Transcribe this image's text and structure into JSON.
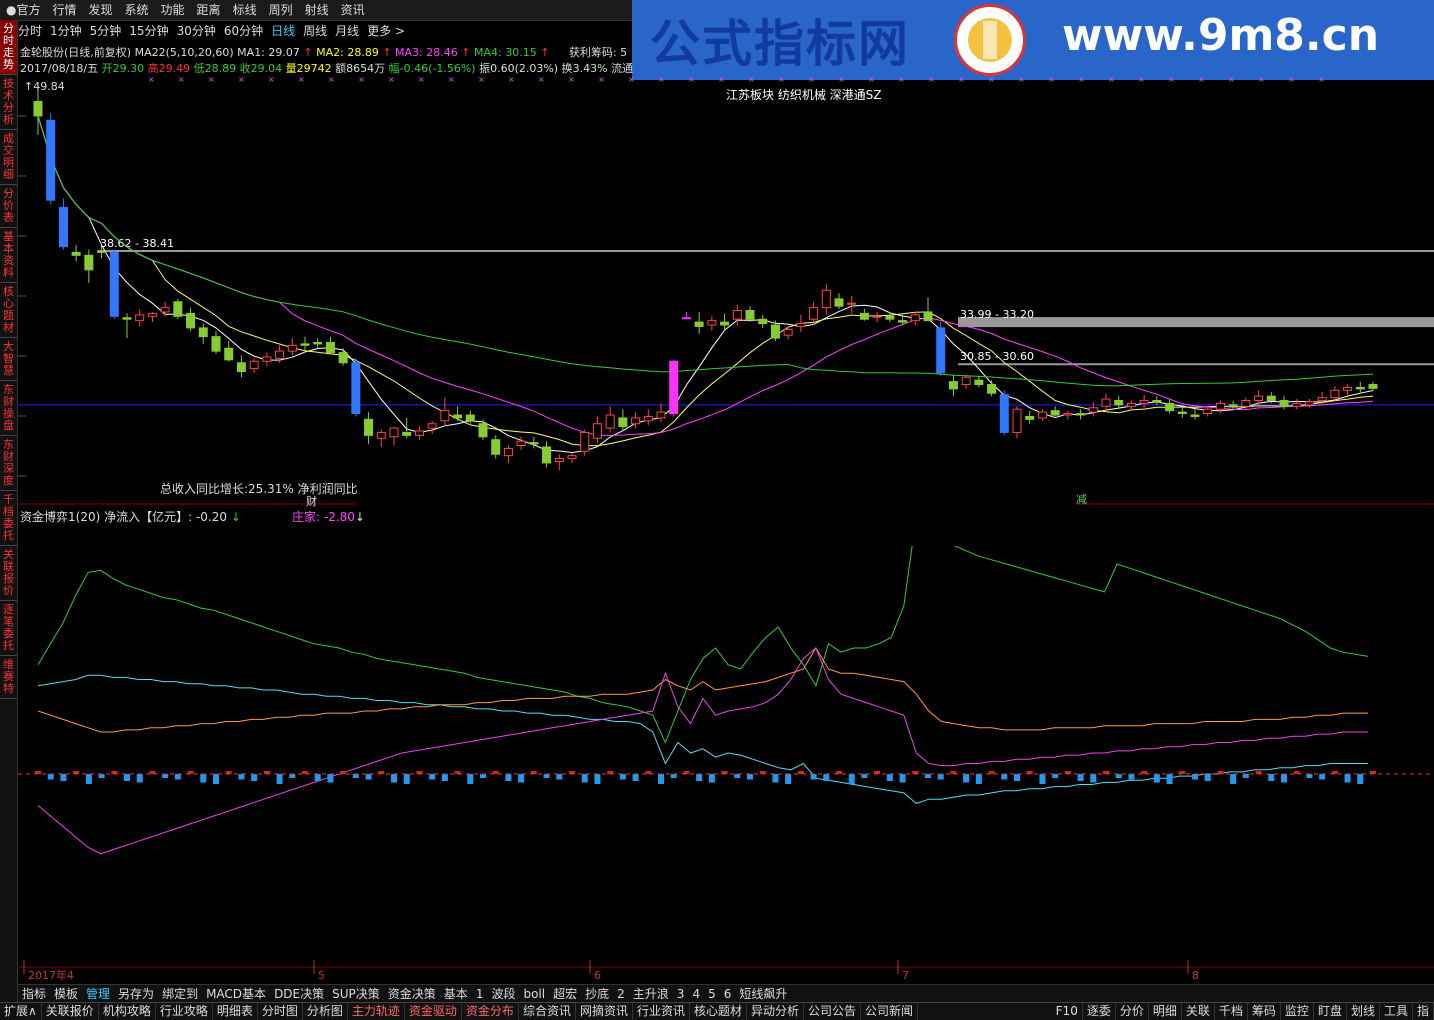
{
  "top_menu": [
    "●官方",
    "行情",
    "发现",
    "系统",
    "功能",
    "距离",
    "标线",
    "周列",
    "射线",
    "资讯"
  ],
  "banner": {
    "title": "公式指标网",
    "url": "www.9m8.cn"
  },
  "sidebar": [
    "分时走势",
    "技术分析",
    "成交明细",
    "分价表",
    "基本资料",
    "核心题材",
    "大智慧",
    "东财操盘",
    "东财深度",
    "千档委托",
    "关联报价",
    "逐笔委托",
    "维赛特"
  ],
  "periods": [
    "分时",
    "1分钟",
    "5分钟",
    "15分钟",
    "30分钟",
    "60分钟",
    "日线",
    "周线",
    "月线",
    "更多 >"
  ],
  "active_period": "日线",
  "stock_line": {
    "name": "金轮股份(日线,前复权)",
    "ma22": "MA22(5,10,20,60)",
    "ma1": "MA1: 29.07",
    "ma2": "MA2: 28.89",
    "ma3": "MA3: 28.46",
    "ma4": "MA4: 30.15",
    "chip": "获利筹码: 5"
  },
  "quote_line": {
    "date": "2017/08/18/五",
    "open": "开29.30",
    "high": "高29.49",
    "low": "低28.89",
    "close": "收29.04",
    "vol": "量29742",
    "amount": "额8654万",
    "range": "幅-0.46(-1.56%)",
    "amp": "振0.60(2.03%)",
    "turn": "换3.43%",
    "flow": "流通"
  },
  "max_label": "49.84",
  "sector_label": "江苏板块 纺织机械 深港通SZ",
  "price_labels": [
    "38.62 - 38.41",
    "33.99 - 33.20",
    "30.85 - 30.60"
  ],
  "growth_text": "总收入同比增长:25.31%  净利润同比增",
  "marker_right": "减",
  "marker_left": "财",
  "indicator": {
    "name": "资金博弈1(20)",
    "net_in": "净流入【亿元】: -0.20",
    "zhuangjia": "庄家: -2.80"
  },
  "xaxis": [
    "2017年4",
    "5",
    "6",
    "7",
    "8"
  ],
  "bottom_tabs": [
    "指标",
    "模板",
    "管理",
    "另存为",
    "绑定到",
    "MACD基本",
    "DDE决策",
    "SUP决策",
    "资金决策",
    "基本",
    "1",
    "波段",
    "boll",
    "超宏",
    "抄底",
    "2",
    "主升浪",
    "3",
    "4",
    "5",
    "6",
    "短线飙升"
  ],
  "active_bottom_tab": "管理",
  "status_tabs": [
    "扩展∧",
    "关联报价",
    "机构攻略",
    "行业攻略",
    "明细表",
    "分时图",
    "分析图",
    "主力轨迹",
    "资金驱动",
    "资金分布",
    "综合资讯",
    "网摘资讯",
    "行业资讯",
    "核心题材",
    "异动分析",
    "公司公告",
    "公司新闻"
  ],
  "status_right": [
    "F10",
    "逐委",
    "分价",
    "明细",
    "关联",
    "千档",
    "筹码",
    "监控",
    "盯盘",
    "划线",
    "工具",
    "指"
  ],
  "chart_data": {
    "type": "candlestick",
    "candles": [
      {
        "o": 48.8,
        "h": 49.84,
        "l": 46.5,
        "c": 47.8,
        "up": false
      },
      {
        "o": 47.5,
        "h": 48.0,
        "l": 41.7,
        "c": 42.0,
        "up": false
      },
      {
        "o": 41.5,
        "h": 42.1,
        "l": 38.6,
        "c": 38.8,
        "up": false
      },
      {
        "o": 38.4,
        "h": 38.9,
        "l": 37.8,
        "c": 38.2,
        "up": false
      },
      {
        "o": 38.2,
        "h": 38.6,
        "l": 36.3,
        "c": 37.2,
        "up": false
      },
      {
        "o": 38.5,
        "h": 38.8,
        "l": 38.0,
        "c": 38.4,
        "up": false
      },
      {
        "o": 38.4,
        "h": 38.62,
        "l": 33.8,
        "c": 34.0,
        "up": false
      },
      {
        "o": 33.9,
        "h": 34.2,
        "l": 32.5,
        "c": 33.8,
        "up": false
      },
      {
        "o": 33.7,
        "h": 34.5,
        "l": 33.3,
        "c": 34.1,
        "up": true
      },
      {
        "o": 34.0,
        "h": 34.3,
        "l": 33.6,
        "c": 34.2,
        "up": true
      },
      {
        "o": 34.3,
        "h": 35.0,
        "l": 34.0,
        "c": 34.6,
        "up": true
      },
      {
        "o": 35.0,
        "h": 35.2,
        "l": 33.8,
        "c": 34.0,
        "up": false
      },
      {
        "o": 34.2,
        "h": 34.6,
        "l": 33.0,
        "c": 33.2,
        "up": false
      },
      {
        "o": 33.2,
        "h": 33.5,
        "l": 32.1,
        "c": 32.6,
        "up": false
      },
      {
        "o": 32.6,
        "h": 33.0,
        "l": 31.4,
        "c": 31.6,
        "up": false
      },
      {
        "o": 31.8,
        "h": 32.3,
        "l": 30.9,
        "c": 31.0,
        "up": false
      },
      {
        "o": 30.8,
        "h": 31.3,
        "l": 29.8,
        "c": 30.2,
        "up": true
      },
      {
        "o": 30.4,
        "h": 31.1,
        "l": 30.1,
        "c": 30.9,
        "up": true
      },
      {
        "o": 30.9,
        "h": 31.5,
        "l": 30.6,
        "c": 31.2,
        "up": true
      },
      {
        "o": 31.1,
        "h": 32.0,
        "l": 30.8,
        "c": 31.6,
        "up": true
      },
      {
        "o": 31.6,
        "h": 32.5,
        "l": 31.3,
        "c": 32.0,
        "up": true
      },
      {
        "o": 32.1,
        "h": 32.6,
        "l": 31.5,
        "c": 32.0,
        "up": false
      },
      {
        "o": 32.2,
        "h": 32.5,
        "l": 31.8,
        "c": 32.1,
        "up": true
      },
      {
        "o": 32.2,
        "h": 32.6,
        "l": 31.4,
        "c": 31.5,
        "up": false
      },
      {
        "o": 31.5,
        "h": 31.8,
        "l": 30.6,
        "c": 30.8,
        "up": false
      },
      {
        "o": 30.8,
        "h": 31.1,
        "l": 27.1,
        "c": 27.3,
        "up": false
      },
      {
        "o": 26.9,
        "h": 27.4,
        "l": 25.2,
        "c": 25.8,
        "up": false
      },
      {
        "o": 25.6,
        "h": 26.2,
        "l": 25.0,
        "c": 26.0,
        "up": true
      },
      {
        "o": 25.7,
        "h": 26.4,
        "l": 25.1,
        "c": 26.3,
        "up": true
      },
      {
        "o": 26.0,
        "h": 27.0,
        "l": 25.6,
        "c": 25.8,
        "up": false
      },
      {
        "o": 25.8,
        "h": 26.4,
        "l": 25.5,
        "c": 26.1,
        "up": true
      },
      {
        "o": 26.3,
        "h": 26.8,
        "l": 25.9,
        "c": 26.6,
        "up": true
      },
      {
        "o": 26.8,
        "h": 28.4,
        "l": 26.5,
        "c": 27.5,
        "up": true
      },
      {
        "o": 27.2,
        "h": 27.8,
        "l": 26.8,
        "c": 27.0,
        "up": false
      },
      {
        "o": 27.2,
        "h": 27.5,
        "l": 26.6,
        "c": 26.8,
        "up": false
      },
      {
        "o": 26.6,
        "h": 26.9,
        "l": 25.5,
        "c": 25.7,
        "up": false
      },
      {
        "o": 25.5,
        "h": 25.8,
        "l": 24.2,
        "c": 24.5,
        "up": false
      },
      {
        "o": 24.4,
        "h": 25.1,
        "l": 23.9,
        "c": 24.9,
        "up": true
      },
      {
        "o": 25.1,
        "h": 25.7,
        "l": 24.8,
        "c": 25.4,
        "up": true
      },
      {
        "o": 25.3,
        "h": 25.7,
        "l": 24.9,
        "c": 25.2,
        "up": false
      },
      {
        "o": 25.0,
        "h": 25.4,
        "l": 23.6,
        "c": 23.9,
        "up": false
      },
      {
        "o": 24.0,
        "h": 24.5,
        "l": 23.4,
        "c": 24.2,
        "up": true
      },
      {
        "o": 24.2,
        "h": 24.6,
        "l": 23.9,
        "c": 24.4,
        "up": true
      },
      {
        "o": 24.7,
        "h": 26.2,
        "l": 24.4,
        "c": 26.0,
        "up": true
      },
      {
        "o": 25.6,
        "h": 27.1,
        "l": 25.3,
        "c": 26.6,
        "up": true
      },
      {
        "o": 26.3,
        "h": 27.8,
        "l": 26.0,
        "c": 27.2,
        "up": true
      },
      {
        "o": 27.0,
        "h": 27.6,
        "l": 26.1,
        "c": 26.4,
        "up": false
      },
      {
        "o": 26.6,
        "h": 27.4,
        "l": 26.3,
        "c": 27.0,
        "up": true
      },
      {
        "o": 26.8,
        "h": 27.6,
        "l": 26.5,
        "c": 27.1,
        "up": true
      },
      {
        "o": 27.0,
        "h": 28.0,
        "l": 26.7,
        "c": 27.4,
        "up": true
      },
      {
        "o": 27.3,
        "h": 31.0,
        "l": 27.1,
        "c": 30.9,
        "up": true,
        "limit": true
      },
      {
        "o": 33.9,
        "h": 34.3,
        "l": 33.8,
        "c": 33.9,
        "up": true,
        "limit": true
      },
      {
        "o": 33.6,
        "h": 34.3,
        "l": 32.8,
        "c": 33.3,
        "up": true
      },
      {
        "o": 33.4,
        "h": 34.0,
        "l": 33.0,
        "c": 33.7,
        "up": true
      },
      {
        "o": 33.6,
        "h": 34.2,
        "l": 33.0,
        "c": 33.4,
        "up": false
      },
      {
        "o": 33.8,
        "h": 34.8,
        "l": 33.4,
        "c": 34.4,
        "up": true
      },
      {
        "o": 34.4,
        "h": 34.7,
        "l": 33.6,
        "c": 33.8,
        "up": false
      },
      {
        "o": 33.8,
        "h": 34.1,
        "l": 33.2,
        "c": 33.5,
        "up": false
      },
      {
        "o": 33.4,
        "h": 33.7,
        "l": 32.3,
        "c": 32.5,
        "up": false
      },
      {
        "o": 32.7,
        "h": 33.3,
        "l": 32.4,
        "c": 33.1,
        "up": true
      },
      {
        "o": 33.3,
        "h": 34.1,
        "l": 32.9,
        "c": 33.5,
        "up": true
      },
      {
        "o": 33.8,
        "h": 35.0,
        "l": 33.4,
        "c": 34.6,
        "up": true
      },
      {
        "o": 34.6,
        "h": 36.2,
        "l": 34.1,
        "c": 35.8,
        "up": true
      },
      {
        "o": 35.2,
        "h": 35.6,
        "l": 34.5,
        "c": 34.7,
        "up": false
      },
      {
        "o": 34.9,
        "h": 35.4,
        "l": 34.2,
        "c": 34.9,
        "up": true
      },
      {
        "o": 34.2,
        "h": 34.5,
        "l": 33.7,
        "c": 33.8,
        "up": false
      },
      {
        "o": 34.0,
        "h": 34.3,
        "l": 33.6,
        "c": 34.0,
        "up": true
      },
      {
        "o": 34.0,
        "h": 34.3,
        "l": 33.6,
        "c": 33.8,
        "up": false
      },
      {
        "o": 33.7,
        "h": 34.1,
        "l": 33.4,
        "c": 33.6,
        "up": false
      },
      {
        "o": 33.7,
        "h": 34.3,
        "l": 33.4,
        "c": 34.1,
        "up": true
      },
      {
        "o": 34.3,
        "h": 35.3,
        "l": 34.0,
        "c": 33.7,
        "up": false
      },
      {
        "o": 33.2,
        "h": 33.6,
        "l": 29.9,
        "c": 30.1,
        "up": false
      },
      {
        "o": 29.5,
        "h": 30.0,
        "l": 28.5,
        "c": 29.0,
        "up": false
      },
      {
        "o": 29.3,
        "h": 30.0,
        "l": 29.0,
        "c": 29.8,
        "up": true
      },
      {
        "o": 29.6,
        "h": 29.9,
        "l": 29.1,
        "c": 29.3,
        "up": false
      },
      {
        "o": 29.3,
        "h": 29.6,
        "l": 28.5,
        "c": 28.7,
        "up": false
      },
      {
        "o": 28.6,
        "h": 28.9,
        "l": 25.8,
        "c": 26.0,
        "up": false
      },
      {
        "o": 26.0,
        "h": 27.8,
        "l": 25.6,
        "c": 27.6,
        "up": true
      },
      {
        "o": 27.1,
        "h": 27.5,
        "l": 26.6,
        "c": 26.9,
        "up": false
      },
      {
        "o": 27.0,
        "h": 27.6,
        "l": 26.8,
        "c": 27.4,
        "up": true
      },
      {
        "o": 27.5,
        "h": 27.8,
        "l": 27.1,
        "c": 27.2,
        "up": false
      },
      {
        "o": 27.2,
        "h": 27.5,
        "l": 26.9,
        "c": 27.3,
        "up": true
      },
      {
        "o": 27.3,
        "h": 27.6,
        "l": 26.9,
        "c": 27.2,
        "up": false
      },
      {
        "o": 27.4,
        "h": 28.1,
        "l": 27.1,
        "c": 27.7,
        "up": true
      },
      {
        "o": 27.8,
        "h": 28.7,
        "l": 27.5,
        "c": 28.3,
        "up": true
      },
      {
        "o": 28.2,
        "h": 28.5,
        "l": 27.7,
        "c": 27.9,
        "up": true
      },
      {
        "o": 27.8,
        "h": 28.2,
        "l": 27.5,
        "c": 28.0,
        "up": false
      },
      {
        "o": 28.0,
        "h": 28.6,
        "l": 27.7,
        "c": 28.2,
        "up": true
      },
      {
        "o": 28.2,
        "h": 28.5,
        "l": 27.9,
        "c": 28.1,
        "up": false
      },
      {
        "o": 28.0,
        "h": 28.3,
        "l": 27.3,
        "c": 27.5,
        "up": false
      },
      {
        "o": 27.4,
        "h": 27.8,
        "l": 27.0,
        "c": 27.3,
        "up": false
      },
      {
        "o": 27.2,
        "h": 27.6,
        "l": 26.9,
        "c": 27.1,
        "up": true
      },
      {
        "o": 27.3,
        "h": 27.8,
        "l": 27.1,
        "c": 27.6,
        "up": true
      },
      {
        "o": 27.6,
        "h": 28.2,
        "l": 27.3,
        "c": 28.0,
        "up": true
      },
      {
        "o": 27.9,
        "h": 28.2,
        "l": 27.6,
        "c": 27.8,
        "up": true
      },
      {
        "o": 27.8,
        "h": 28.4,
        "l": 27.6,
        "c": 28.2,
        "up": true
      },
      {
        "o": 28.2,
        "h": 28.9,
        "l": 27.9,
        "c": 28.5,
        "up": true
      },
      {
        "o": 28.5,
        "h": 28.8,
        "l": 28.0,
        "c": 28.2,
        "up": false
      },
      {
        "o": 28.2,
        "h": 28.5,
        "l": 27.6,
        "c": 27.8,
        "up": false
      },
      {
        "o": 27.8,
        "h": 28.3,
        "l": 27.6,
        "c": 28.0,
        "up": true
      },
      {
        "o": 27.9,
        "h": 28.3,
        "l": 27.7,
        "c": 28.1,
        "up": true
      },
      {
        "o": 28.2,
        "h": 28.8,
        "l": 27.9,
        "c": 28.4,
        "up": true
      },
      {
        "o": 28.4,
        "h": 29.2,
        "l": 28.1,
        "c": 28.9,
        "up": true
      },
      {
        "o": 28.9,
        "h": 29.3,
        "l": 28.6,
        "c": 29.1,
        "up": true
      },
      {
        "o": 29.1,
        "h": 29.5,
        "l": 28.7,
        "c": 29.0,
        "up": false
      },
      {
        "o": 29.3,
        "h": 29.49,
        "l": 28.89,
        "c": 29.04,
        "up": false
      }
    ],
    "ylim": [
      23,
      50
    ],
    "ma_colors": {
      "ma5": "#ffffff",
      "ma10": "#ffff66",
      "ma20": "#ff44ff",
      "ma60": "#33cc33"
    },
    "hlines": [
      {
        "label": "38.62 - 38.41",
        "y": 38.5
      },
      {
        "label": "33.99 - 33.20",
        "y": 33.6
      },
      {
        "label": "30.85 - 30.60",
        "y": 30.7
      }
    ],
    "blue_hline": 27.9,
    "indicator_series": {
      "green": [
        52,
        62,
        72,
        85,
        96,
        97,
        93,
        90,
        88,
        86,
        84,
        83,
        81,
        79,
        78,
        76,
        74,
        72,
        70,
        68,
        66,
        64,
        62,
        61,
        60,
        58,
        57,
        55,
        54,
        53,
        52,
        51,
        50,
        49,
        48,
        46,
        45,
        44,
        43,
        42,
        41,
        40,
        39,
        37,
        36,
        34,
        33,
        32,
        30,
        28,
        15,
        30,
        45,
        55,
        60,
        52,
        50,
        58,
        65,
        70,
        60,
        52,
        42,
        62,
        58,
        60,
        60,
        62,
        65,
        80,
        170,
        140,
        132,
        128,
        125,
        122,
        120,
        118,
        116,
        114,
        112,
        110,
        108,
        106,
        104,
        102,
        100,
        98,
        96,
        94,
        92,
        90,
        88,
        86,
        84,
        82,
        80,
        78,
        76,
        74,
        71,
        68,
        64,
        60,
        58,
        57,
        56
      ],
      "cyan": [
        42,
        43,
        44,
        45,
        47,
        47,
        46,
        46,
        45,
        45,
        44,
        44,
        43,
        43,
        42,
        42,
        41,
        41,
        40,
        40,
        39,
        38,
        38,
        37,
        37,
        36,
        36,
        35,
        35,
        34,
        34,
        33,
        33,
        32,
        32,
        31,
        31,
        30,
        30,
        29,
        29,
        28,
        28,
        27,
        26,
        26,
        25,
        25,
        24,
        20,
        5,
        15,
        10,
        12,
        8,
        10,
        9,
        7,
        5,
        3,
        2,
        5,
        -2,
        -3,
        -4,
        -5,
        -6,
        -7,
        -8,
        -9,
        -14,
        -12,
        -12,
        -11,
        -10,
        -10,
        -9,
        -8,
        -8,
        -7,
        -7,
        -6,
        -6,
        -5,
        -5,
        -4,
        -4,
        -3,
        -3,
        -2,
        -2,
        -1,
        -1,
        0,
        0,
        1,
        1,
        2,
        2,
        3,
        3,
        4,
        4,
        5,
        5,
        5,
        5
      ],
      "orange": [
        30,
        28,
        26,
        24,
        22,
        20,
        20,
        21,
        21,
        22,
        22,
        23,
        23,
        24,
        24,
        25,
        25,
        26,
        26,
        27,
        27,
        28,
        28,
        29,
        29,
        29,
        30,
        30,
        31,
        31,
        32,
        32,
        33,
        33,
        33,
        34,
        34,
        35,
        35,
        36,
        36,
        36,
        37,
        37,
        37,
        38,
        38,
        38,
        39,
        40,
        45,
        42,
        40,
        44,
        40,
        41,
        42,
        43,
        44,
        46,
        48,
        50,
        60,
        50,
        48,
        48,
        47,
        46,
        45,
        44,
        38,
        30,
        25,
        24,
        23,
        22,
        22,
        21,
        21,
        21,
        21,
        22,
        22,
        22,
        22,
        23,
        23,
        23,
        23,
        24,
        24,
        24,
        24,
        25,
        25,
        25,
        25,
        26,
        26,
        26,
        27,
        27,
        28,
        28,
        29,
        29,
        29
      ],
      "magenta": [
        -15,
        -20,
        -25,
        -30,
        -35,
        -38,
        -36,
        -34,
        -32,
        -30,
        -28,
        -26,
        -24,
        -22,
        -20,
        -18,
        -16,
        -14,
        -12,
        -10,
        -8,
        -6,
        -4,
        -2,
        0,
        2,
        4,
        6,
        8,
        10,
        11,
        12,
        13,
        14,
        15,
        16,
        17,
        18,
        19,
        20,
        21,
        22,
        23,
        24,
        25,
        26,
        27,
        28,
        29,
        30,
        48,
        32,
        24,
        36,
        28,
        30,
        31,
        32,
        34,
        38,
        45,
        55,
        60,
        45,
        38,
        36,
        34,
        32,
        30,
        28,
        10,
        5,
        4,
        4,
        5,
        5,
        6,
        6,
        7,
        7,
        8,
        8,
        9,
        9,
        10,
        10,
        11,
        11,
        12,
        12,
        13,
        13,
        14,
        14,
        15,
        15,
        16,
        16,
        17,
        17,
        18,
        18,
        19,
        19,
        20,
        20,
        20
      ]
    }
  }
}
